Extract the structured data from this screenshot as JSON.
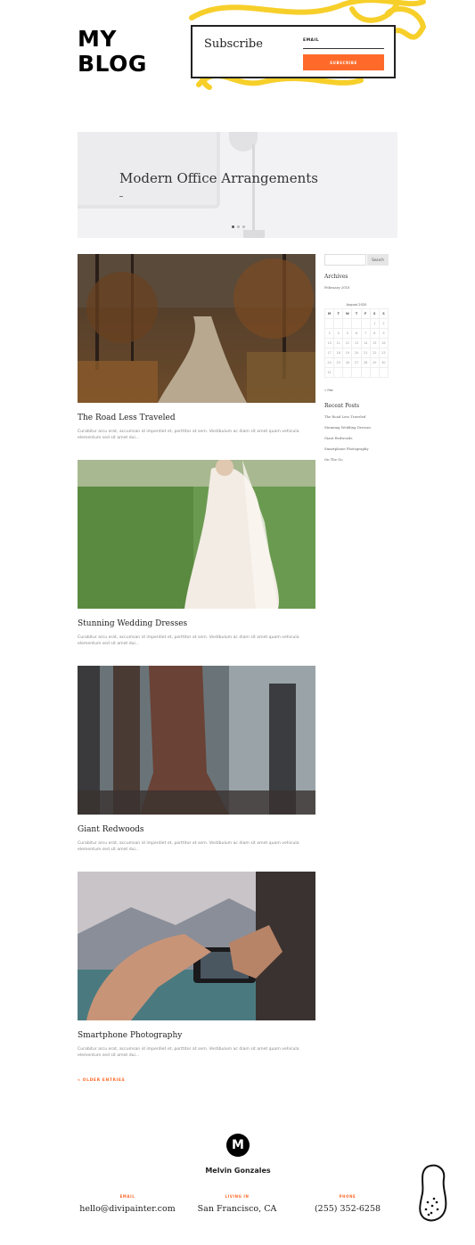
{
  "header": {
    "logo": "MY\nBLOG",
    "subscribe": {
      "title": "Subscribe",
      "email_label": "EMAIL",
      "button_label": "SUBSCRIBE"
    }
  },
  "slider": {
    "title": "Modern Office Arrangements",
    "slide_count": 3,
    "active_slide": 1
  },
  "posts": [
    {
      "title": "The Road Less Traveled",
      "excerpt": "Curabitur arcu erat, accumsan id imperdiet et, porttitor at sem. Vestibulum ac diam sit amet quam vehicula elementum sed sit amet dui..."
    },
    {
      "title": "Stunning Wedding Dresses",
      "excerpt": "Curabitur arcu erat, accumsan id imperdiet et, porttitor at sem. Vestibulum ac diam sit amet quam vehicula elementum sed sit amet dui..."
    },
    {
      "title": "Giant Redwoods",
      "excerpt": "Curabitur arcu erat, accumsan id imperdiet et, porttitor at sem. Vestibulum ac diam sit amet quam vehicula elementum sed sit amet dui..."
    },
    {
      "title": "Smartphone Photography",
      "excerpt": "Curabitur arcu erat, accumsan id imperdiet et, porttitor at sem. Vestibulum ac diam sit amet quam vehicula elementum sed sit amet dui..."
    }
  ],
  "older_entries": "« OLDER ENTRIES",
  "sidebar": {
    "search_button": "Search",
    "archives_heading": "Archives",
    "archives": [
      "February 2018"
    ],
    "calendar": {
      "caption": "August 2020",
      "weekdays": [
        "M",
        "T",
        "W",
        "T",
        "F",
        "S",
        "S"
      ],
      "weeks": [
        [
          "",
          "",
          "",
          "",
          "",
          "1",
          "2"
        ],
        [
          "3",
          "4",
          "5",
          "6",
          "7",
          "8",
          "9"
        ],
        [
          "10",
          "11",
          "12",
          "13",
          "14",
          "15",
          "16"
        ],
        [
          "17",
          "18",
          "19",
          "20",
          "21",
          "22",
          "23"
        ],
        [
          "24",
          "25",
          "26",
          "27",
          "28",
          "29",
          "30"
        ],
        [
          "31",
          "",
          "",
          "",
          "",
          "",
          ""
        ]
      ],
      "prev_link": "« Feb"
    },
    "recent_heading": "Recent Posts",
    "recent": [
      "The Road Less Traveled",
      "Stunning Wedding Dresses",
      "Giant Redwoods",
      "Smartphone Photography",
      "On The Go"
    ]
  },
  "footer": {
    "logo_letter": "M",
    "name": "Melvin Gonzales",
    "columns": [
      {
        "label": "EMAIL",
        "value": "hello@divipainter.com"
      },
      {
        "label": "LIVING IN",
        "value": "San Francisco, CA"
      },
      {
        "label": "PHONE",
        "value": "(255) 352-6258"
      }
    ]
  },
  "colors": {
    "accent": "#ff6a2a",
    "scribble": "#f7cf2a"
  }
}
